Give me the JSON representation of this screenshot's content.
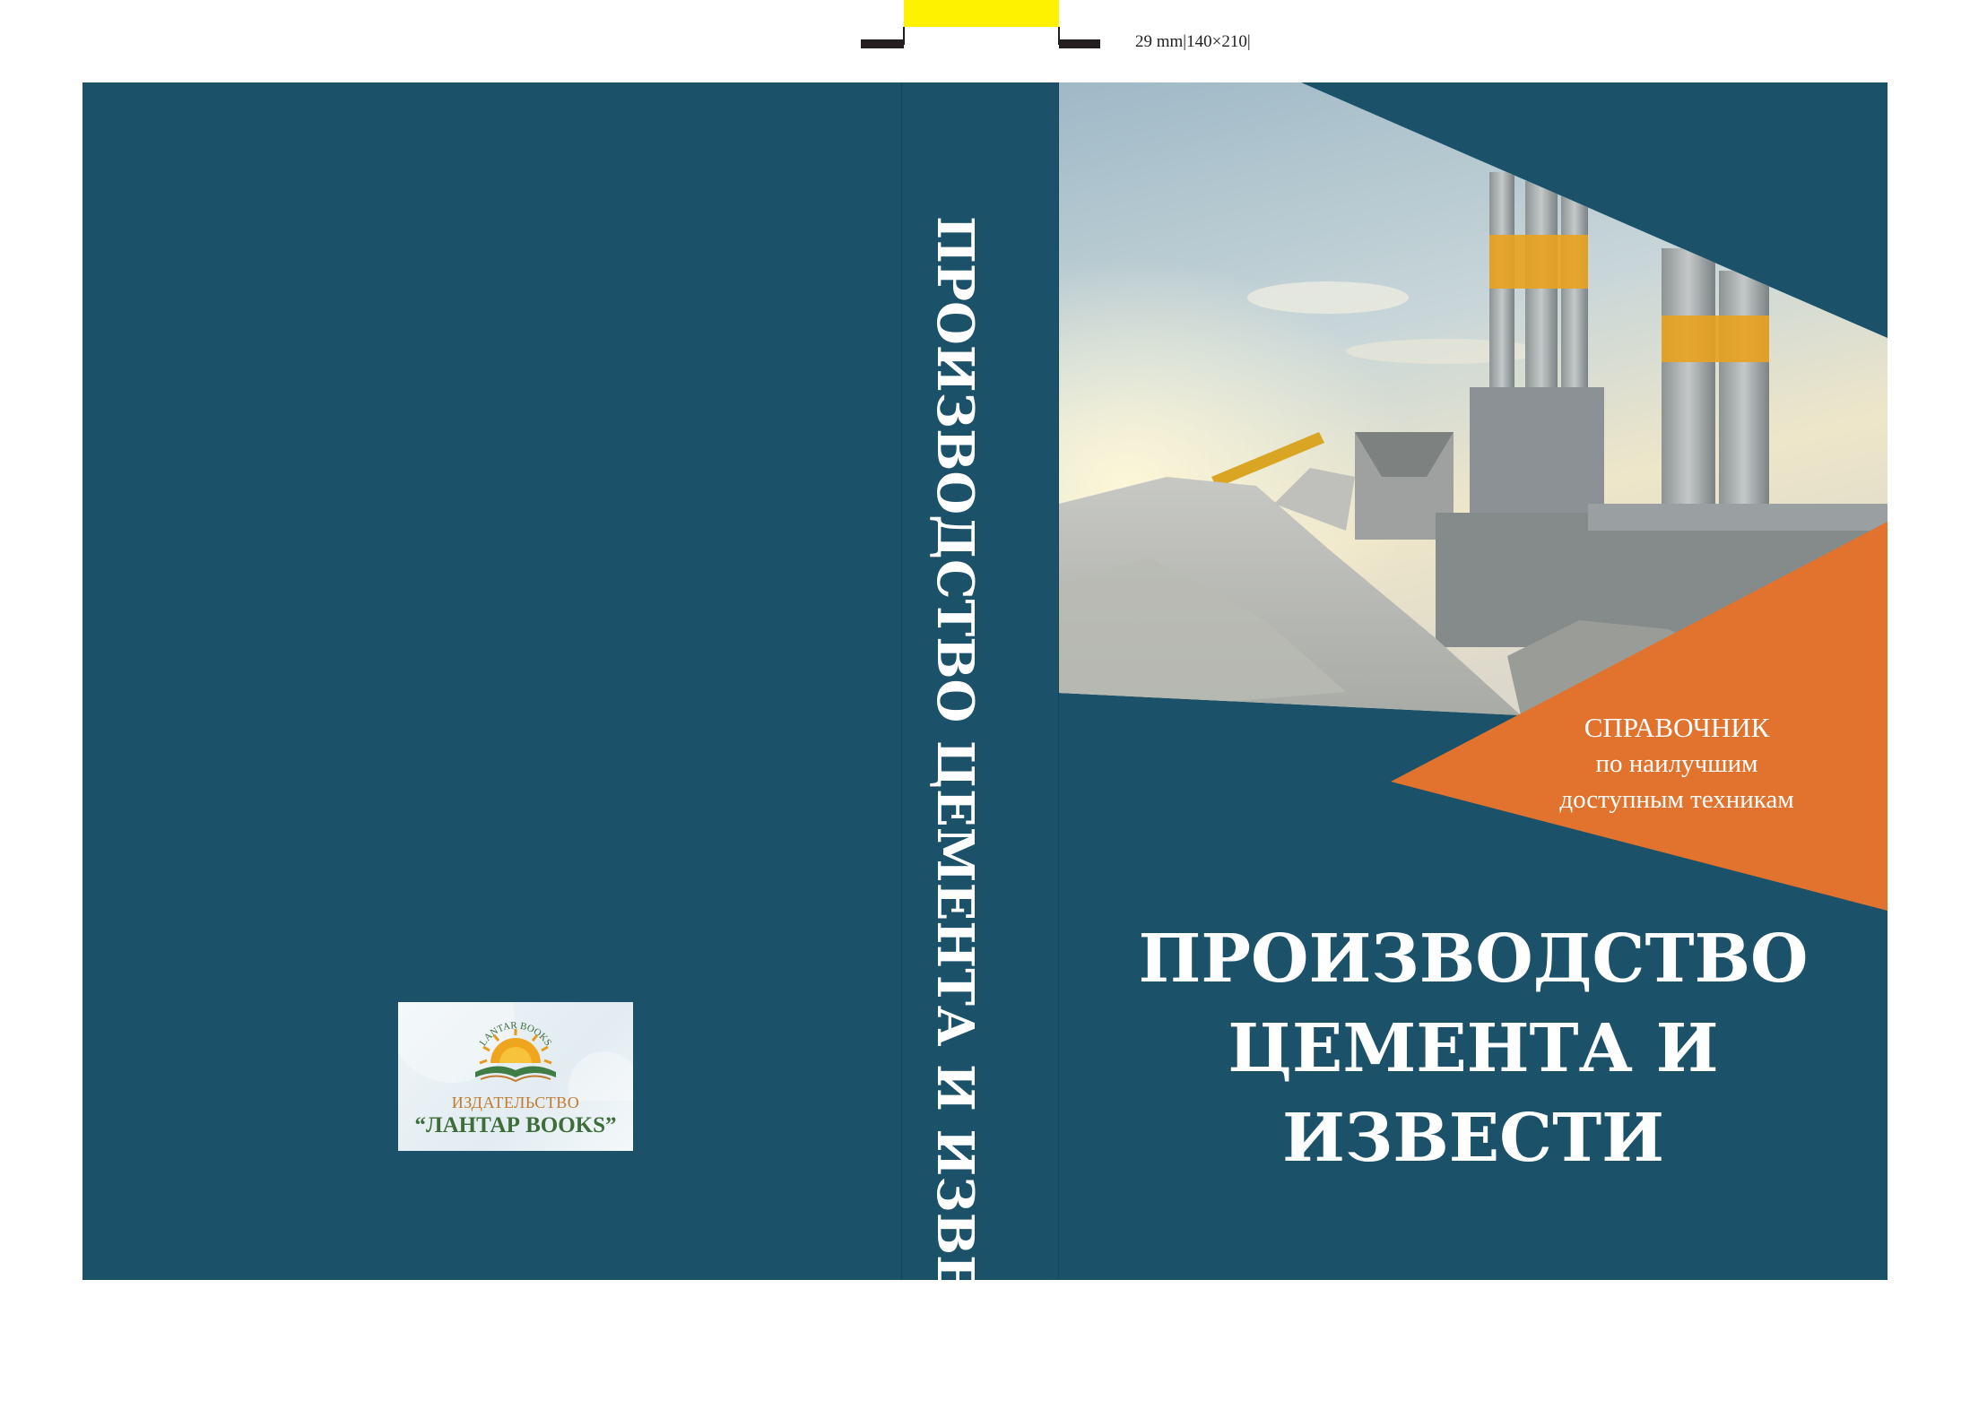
{
  "print_marks": {
    "spec_text": "29 mm|140×210|"
  },
  "spine": {
    "title": "ПРОИЗВОДСТВО ЦЕМЕНТА И ИЗВЕСТИ"
  },
  "front": {
    "subtitle_line1": "СПРАВОЧНИК",
    "subtitle_line2": "по наилучшим",
    "subtitle_line3": "доступным техникам",
    "title_line1": "ПРОИЗВОДСТВО",
    "title_line2": "ЦЕМЕНТА И ИЗВЕСТИ"
  },
  "publisher": {
    "emblem_text": "LANTAR BOOKS",
    "line1": "ИЗДАТЕЛЬСТВО",
    "line2": "“ЛАНТАР BOOKS”"
  },
  "colors": {
    "cover_background": "#1b5169",
    "accent_orange": "#e1732e",
    "registration_yellow": "#fff200"
  }
}
